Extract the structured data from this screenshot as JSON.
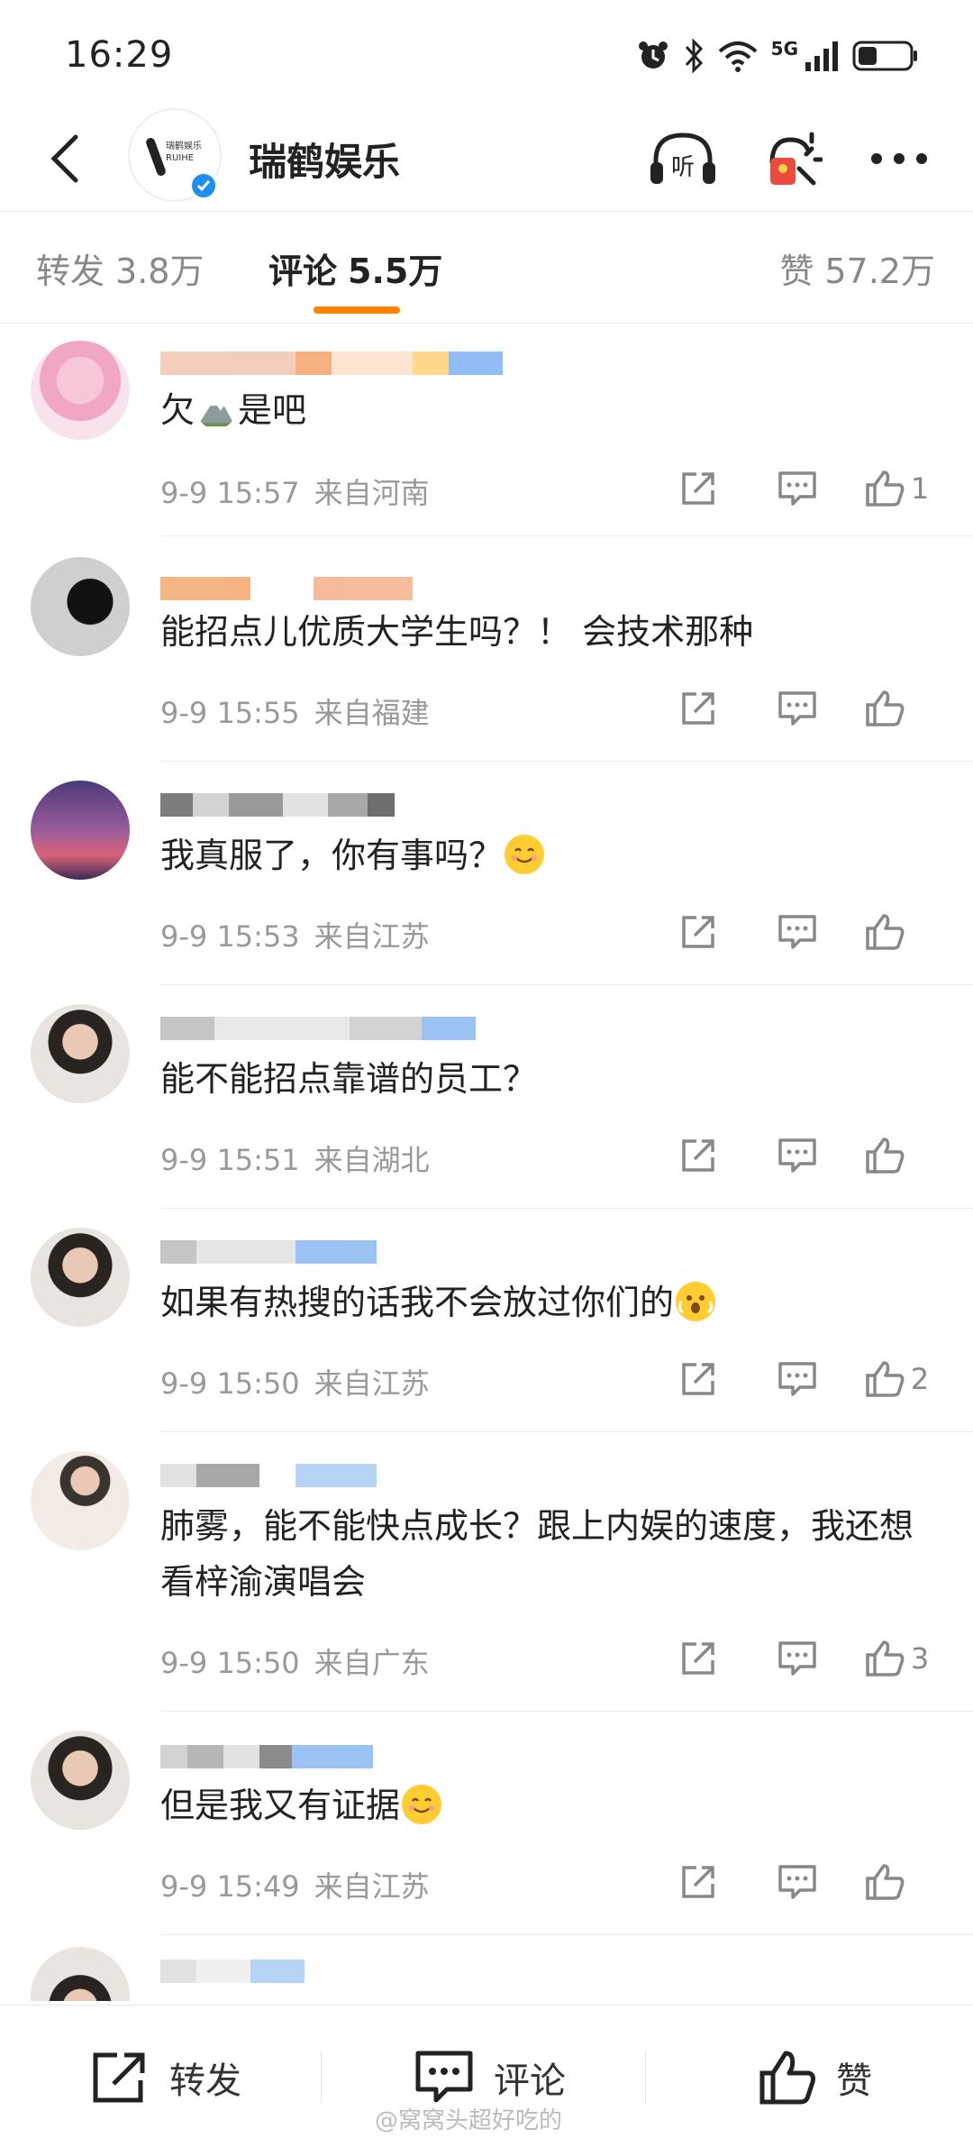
{
  "status_bar": {
    "time": "16:29",
    "network": "5G"
  },
  "header": {
    "title": "瑞鹤娱乐",
    "listen_label": "听"
  },
  "tabs": [
    {
      "label": "转发",
      "count": "3.8万"
    },
    {
      "label": "评论",
      "count": "5.5万"
    },
    {
      "label": "赞",
      "count": "57.2万"
    }
  ],
  "comments": [
    {
      "text": "欠",
      "text_after": "是吧",
      "time": "9-9 15:57",
      "location": "来自河南",
      "likes": "1"
    },
    {
      "text": "能招点儿优质大学生吗？！ 会技术那种",
      "time": "9-9 15:55",
      "location": "来自福建",
      "likes": ""
    },
    {
      "text": "我真服了，你有事吗？",
      "time": "9-9 15:53",
      "location": "来自江苏",
      "likes": ""
    },
    {
      "text": "能不能招点靠谱的员工？",
      "time": "9-9 15:51",
      "location": "来自湖北",
      "likes": ""
    },
    {
      "text": "如果有热搜的话我不会放过你们的",
      "time": "9-9 15:50",
      "location": "来自江苏",
      "likes": "2"
    },
    {
      "text": "肺雾，能不能快点成长？跟上内娱的速度，我还想看梓渝演唱会",
      "time": "9-9 15:50",
      "location": "来自广东",
      "likes": "3"
    },
    {
      "text": "但是我又有证据",
      "time": "9-9 15:49",
      "location": "来自江苏",
      "likes": ""
    }
  ],
  "bottom_bar": {
    "repost": "转发",
    "comment": "评论",
    "like": "赞"
  },
  "watermark": "@窝窝头超好吃的",
  "colors": {
    "accent": "#ff8200",
    "verified": "#1f8ef1",
    "text_secondary": "#999999"
  }
}
